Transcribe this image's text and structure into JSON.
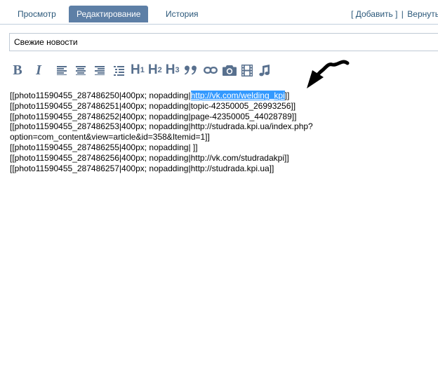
{
  "tabs": {
    "preview": "Просмотр",
    "edit": "Редактирование",
    "history": "История"
  },
  "actions": {
    "add": "[ Добавить ]",
    "separator": "|",
    "return": "Вернуть"
  },
  "title": {
    "value": "Свежие новости"
  },
  "toolbar": {
    "bold": "B",
    "italic": "I",
    "h1_letter": "H",
    "h1_num": "1",
    "h2_letter": "H",
    "h2_num": "2",
    "h3_letter": "H",
    "h3_num": "3",
    "quote": "99",
    "icons": [
      "bold-icon",
      "italic-icon",
      "align-left-icon",
      "align-center-icon",
      "align-right-icon",
      "list-icon",
      "h1-icon",
      "h2-icon",
      "h3-icon",
      "quote-icon",
      "link-icon",
      "camera-icon",
      "film-icon",
      "music-note-icon"
    ]
  },
  "content": {
    "line1_prefix": "[[photo11590455_287486250|400px; nopadding|",
    "line1_selected": "http://vk.com/welding_kpi",
    "line1_suffix": "]]",
    "line2": "[[photo11590455_287486251|400px; nopadding|topic-42350005_26993256]]",
    "line3": "[[photo11590455_287486252|400px; nopadding|page-42350005_44028789]]",
    "line4": "[[photo11590455_287486253|400px; nopadding|http://studrada.kpi.ua/index.php?",
    "line5": "option=com_content&view=article&id=358&Itemid=1]]",
    "line6": "[[photo11590455_287486255|400px; nopadding| ]]",
    "line7": "[[photo11590455_287486256|400px; nopadding|http://vk.com/studradakpi]]",
    "line8": "[[photo11590455_287486257|400px; nopadding|http://studrada.kpi.ua]]"
  },
  "colors": {
    "accent": "#5d7fa6",
    "link": "#2b587a",
    "toolbar_icon": "#58708e",
    "selection": "#3399ff"
  }
}
